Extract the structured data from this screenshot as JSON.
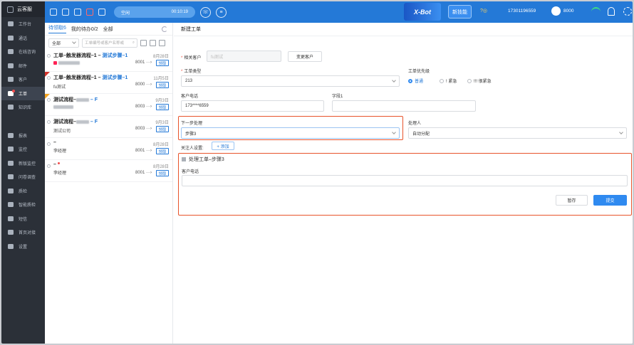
{
  "sidebar": {
    "brand": "云客服",
    "items": [
      {
        "label": "工作台"
      },
      {
        "label": "通话"
      },
      {
        "label": "在线咨询"
      },
      {
        "label": "邮件"
      },
      {
        "label": "客户"
      },
      {
        "label": "工单"
      },
      {
        "label": "知识库"
      },
      {
        "label": "报表"
      },
      {
        "label": "监控"
      },
      {
        "label": "新版监控"
      },
      {
        "label": "问卷调查"
      },
      {
        "label": "质检"
      },
      {
        "label": "智能质检"
      },
      {
        "label": "短信"
      },
      {
        "label": "首页对接"
      },
      {
        "label": "设置"
      }
    ]
  },
  "topbar": {
    "status": "空闲",
    "timer": "00:10:19",
    "banner": "X-Bot",
    "new_version": "新技能",
    "phone": "17301196559",
    "extension": "8000",
    "colors": {
      "bar": "#2479d7",
      "accent": "#2f8af0",
      "highlight": "#e8532b"
    }
  },
  "list": {
    "tabs": [
      "待领取6",
      "我的待办0/2",
      "全部"
    ],
    "filter_value": "全部",
    "search_placeholder": "工单编号或客户名称或",
    "claim_label": "领取",
    "cards": [
      {
        "title": "工单–触发器流程–1 –",
        "step": "测试步骤–1",
        "date": "8月28日",
        "num": "8001 ···›"
      },
      {
        "title": "工单–触发器流程–1 –",
        "step": "测试步骤–1",
        "date": "11月5日",
        "sub": "fu测试",
        "num": "8000 ···›"
      },
      {
        "title": "测试流程–",
        "step": "– F",
        "date": "9月3日",
        "num": "8003 ···›"
      },
      {
        "title": "测试流程–",
        "step": "– F",
        "date": "9月3日",
        "sub": "测试公司",
        "num": "8003 ···›"
      },
      {
        "title": "–",
        "date": "8月28日",
        "sub": "李经理",
        "num": "8001 ···›"
      },
      {
        "title": "–",
        "date": "8月28日",
        "sub": "李经理",
        "num": "8001 ···›"
      }
    ]
  },
  "form": {
    "title": "新建工单",
    "related_customer_label": "相关客户",
    "related_customer_value": "fu测试",
    "change_customer": "变更客户",
    "ticket_type_label": "工单类型",
    "ticket_type_value": "213",
    "priority_label": "工单优先级",
    "priorities": [
      "普通",
      "! 紧急",
      "!!! 很紧急"
    ],
    "customer_phone_label": "客户电话",
    "customer_phone_value": "173****6559",
    "field1_label": "字段1",
    "next_step_label": "下一步处理",
    "next_step_value": "步骤3",
    "handler_label": "处理人",
    "handler_value": "自动分配",
    "followers_label": "关注人设置:",
    "add_button": "+ 添加",
    "section_title": "处理工单–步骤3",
    "section_phone_label": "客户电话",
    "save_button": "暂存",
    "submit_button": "提交"
  }
}
